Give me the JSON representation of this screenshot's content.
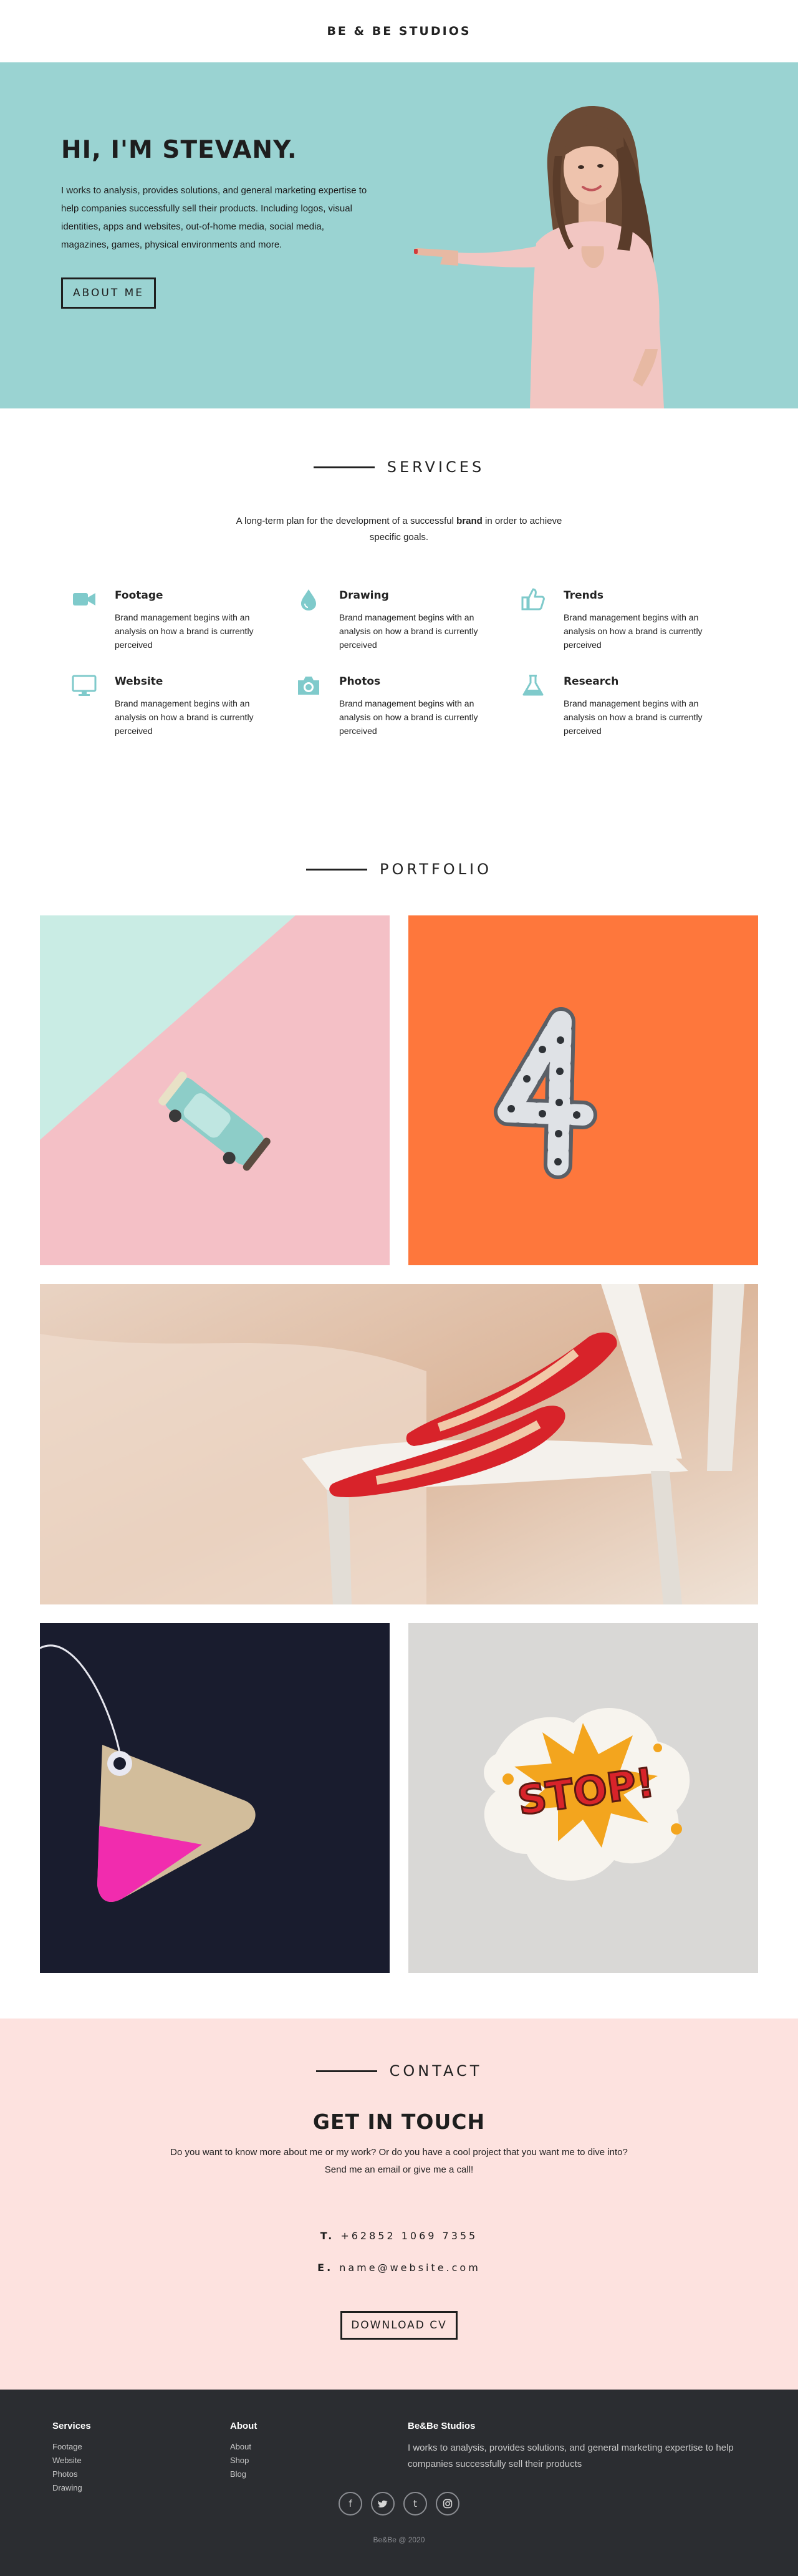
{
  "header": {
    "brand": "BE & BE STUDIOS"
  },
  "hero": {
    "title": "HI, I'M STEVANY.",
    "description": "I works to analysis, provides solutions, and general marketing expertise to help companies successfully sell their products. Including logos, visual identities, apps and websites, out-of-home media, social media, magazines, games, physical environments and more.",
    "button": "ABOUT ME",
    "bg_color": "#9ad3d2"
  },
  "services": {
    "title": "SERVICES",
    "intro_before": "A long-term plan for the development of a successful ",
    "intro_bold": "brand",
    "intro_after": " in order to achieve specific goals.",
    "accent_color": "#7fcacb",
    "items": [
      {
        "name": "Footage",
        "icon": "video-camera-icon",
        "desc": "Brand management begins with an analysis on how a brand is currently perceived"
      },
      {
        "name": "Drawing",
        "icon": "drop-icon",
        "desc": "Brand management begins with an analysis on how a brand is currently perceived"
      },
      {
        "name": "Trends",
        "icon": "thumbs-up-icon",
        "desc": "Brand management begins with an analysis on how a brand is currently perceived"
      },
      {
        "name": "Website",
        "icon": "monitor-icon",
        "desc": "Brand management begins with an analysis on how a brand is currently perceived"
      },
      {
        "name": "Photos",
        "icon": "camera-icon",
        "desc": "Brand management begins with an analysis on how a brand is currently perceived"
      },
      {
        "name": "Research",
        "icon": "flask-icon",
        "desc": "Brand management begins with an analysis on how a brand is currently perceived"
      }
    ]
  },
  "portfolio": {
    "title": "PORTFOLIO",
    "items": [
      {
        "name": "toy-car-image"
      },
      {
        "name": "bike-chain-number-image"
      },
      {
        "name": "red-shoes-image"
      },
      {
        "name": "price-tag-image"
      },
      {
        "name": "stop-sticker-image",
        "sticker_text": "STOP!"
      }
    ]
  },
  "contact": {
    "title": "CONTACT",
    "heading": "GET IN TOUCH",
    "text_line1": "Do you want to know more about me or my work? Or do you have a cool project that you want me to dive into?",
    "text_line2": "Send me an email or give me a call!",
    "phone_label": "T.",
    "phone": "+62852 1069 7355",
    "email_label": "E.",
    "email": "name@website.com",
    "button": "DOWNLOAD CV",
    "bg_color": "#fde2df"
  },
  "footer": {
    "col1": {
      "title": "Services",
      "links": [
        "Footage",
        "Website",
        "Photos",
        "Drawing"
      ]
    },
    "col2": {
      "title": "About",
      "links": [
        "About",
        "Shop",
        "Blog"
      ]
    },
    "col3": {
      "title": "Be&Be Studios",
      "text": "I works to analysis, provides solutions, and general marketing expertise to help companies successfully sell their products"
    },
    "socials": [
      {
        "icon": "facebook-icon",
        "glyph": "f"
      },
      {
        "icon": "twitter-icon",
        "glyph": "t"
      },
      {
        "icon": "tumblr-icon",
        "glyph": "t"
      },
      {
        "icon": "instagram-icon",
        "glyph": "◎"
      }
    ],
    "copyright": "Be&Be @ 2020"
  }
}
